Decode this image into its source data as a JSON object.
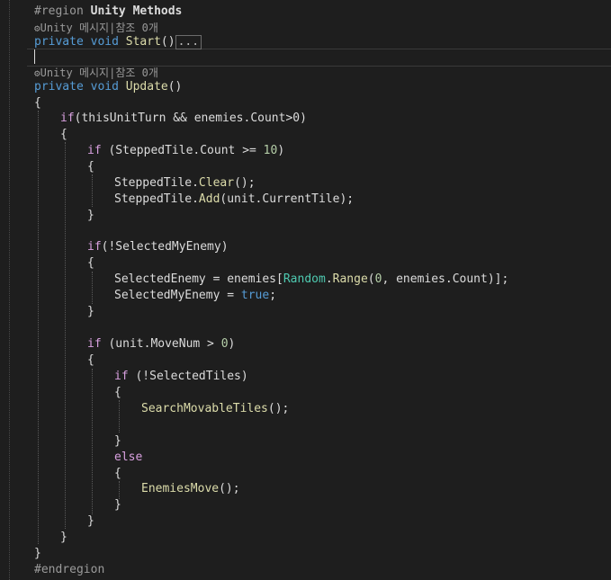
{
  "region": {
    "directive": "#region",
    "name": "Unity Methods",
    "end": "#endregion"
  },
  "codelens": {
    "gear_icon": "⚙",
    "text": "Unity 메시지|참조 0개"
  },
  "start_method": {
    "mod": "private",
    "ret": "void",
    "name": "Start",
    "paren": "()",
    "collapsed": "..."
  },
  "update_method": {
    "mod": "private",
    "ret": "void",
    "name": "Update",
    "paren": "()"
  },
  "braces": {
    "open": "{",
    "close": "}"
  },
  "code": {
    "if1": {
      "kw": "if",
      "rest": "(thisUnitTurn && enemies.Count>0)"
    },
    "if2": {
      "kw": "if",
      "a": " (SteppedTile.Count >= ",
      "n": "10",
      "b": ")"
    },
    "clear": {
      "obj": "SteppedTile.",
      "m": "Clear",
      "rest": "();"
    },
    "add": {
      "obj": "SteppedTile.",
      "m": "Add",
      "rest": "(unit.CurrentTile);"
    },
    "if3": {
      "kw": "if",
      "rest": "(!SelectedMyEnemy)"
    },
    "sel_enemy": {
      "a": "SelectedEnemy = enemies[",
      "type": "Random",
      "dot": ".",
      "m": "Range",
      "p": "(",
      "n": "0",
      "rest": ", enemies.Count)];"
    },
    "sel_my": {
      "a": "SelectedMyEnemy = ",
      "kw": "true",
      "rest": ";"
    },
    "if4": {
      "kw": "if",
      "a": " (unit.MoveNum > ",
      "n": "0",
      "b": ")"
    },
    "if5": {
      "kw": "if",
      "rest": " (!SelectedTiles)"
    },
    "search": {
      "m": "SearchMovableTiles",
      "rest": "();"
    },
    "else": {
      "kw": "else"
    },
    "move": {
      "m": "EnemiesMove",
      "rest": "();"
    }
  },
  "colors": {
    "background": "#1e1e1e",
    "keyword": "#569cd6",
    "control": "#d8a0df",
    "type": "#4ec9b0",
    "method": "#dcdcaa",
    "number": "#b5cea8",
    "text": "#dcdcdc"
  }
}
